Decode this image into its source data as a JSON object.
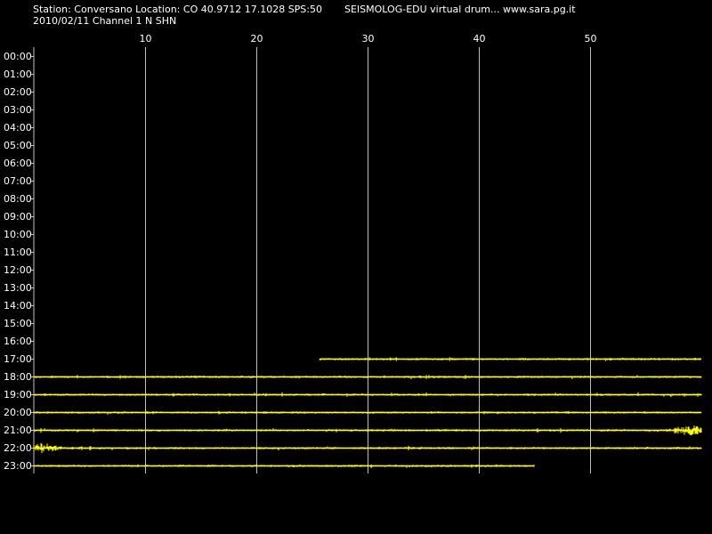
{
  "header": {
    "station_line": "Station: Conversano Location: CO 40.9712 17.1028 SPS:50",
    "product_line": "SEISMOLOG-EDU virtual drum... www.sara.pg.it",
    "date_channel_line": "2010/02/11  Channel 1 N SHN"
  },
  "colors": {
    "background": "#000000",
    "text": "#ffffff",
    "grid": "#c0c0c0",
    "trace": "#ffff00"
  },
  "chart_data": {
    "type": "line",
    "title": "",
    "xlabel": "",
    "ylabel": "",
    "xlim": [
      0,
      60
    ],
    "x_ticks": [
      10,
      20,
      30,
      40,
      50
    ],
    "x_tick_labels": [
      "10",
      "20",
      "30",
      "40",
      "50"
    ],
    "hour_labels": [
      "00:00",
      "01:00",
      "02:00",
      "03:00",
      "04:00",
      "05:00",
      "06:00",
      "07:00",
      "08:00",
      "09:00",
      "10:00",
      "11:00",
      "12:00",
      "13:00",
      "14:00",
      "15:00",
      "16:00",
      "17:00",
      "18:00",
      "19:00",
      "20:00",
      "21:00",
      "22:00",
      "23:00"
    ],
    "grid": true,
    "series": [
      {
        "hour": "17:00",
        "start_min": 25.7,
        "end_min": 60,
        "amplitude": "low"
      },
      {
        "hour": "18:00",
        "start_min": 0,
        "end_min": 60,
        "amplitude": "low"
      },
      {
        "hour": "19:00",
        "start_min": 0,
        "end_min": 60,
        "amplitude": "low"
      },
      {
        "hour": "20:00",
        "start_min": 0,
        "end_min": 60,
        "amplitude": "low"
      },
      {
        "hour": "21:00",
        "start_min": 0,
        "end_min": 60,
        "amplitude": "low",
        "burst_at_min": 59
      },
      {
        "hour": "22:00",
        "start_min": 0,
        "end_min": 60,
        "amplitude": "low",
        "burst_at_min": 0.6
      },
      {
        "hour": "23:00",
        "start_min": 0,
        "end_min": 45,
        "amplitude": "low"
      }
    ]
  }
}
